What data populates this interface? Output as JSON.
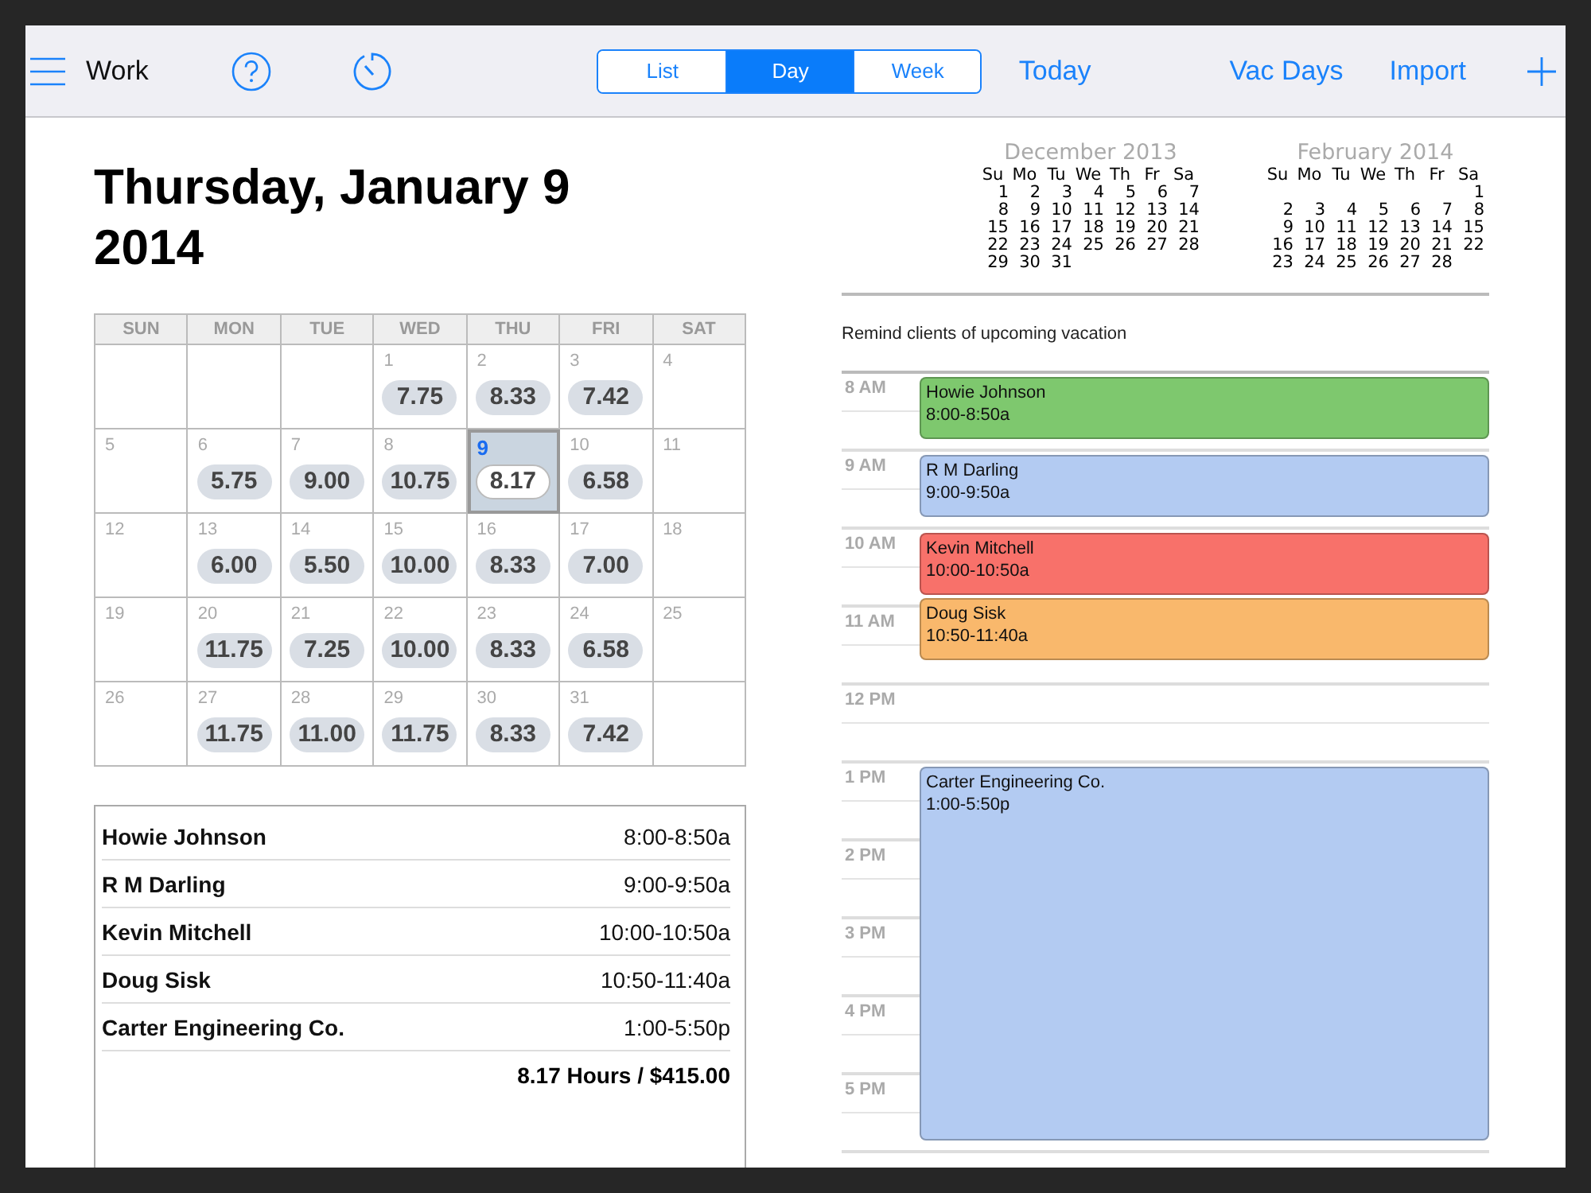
{
  "toolbar": {
    "title": "Work",
    "segments": [
      {
        "label": "List",
        "selected": false
      },
      {
        "label": "Day",
        "selected": true
      },
      {
        "label": "Week",
        "selected": false
      }
    ],
    "links": [
      "Today",
      "Vac Days",
      "Import"
    ]
  },
  "day_title": "Thursday, January 9 2014",
  "month_grid": {
    "weekdays": [
      "SUN",
      "MON",
      "TUE",
      "WED",
      "THU",
      "FRI",
      "SAT"
    ],
    "weeks": [
      [
        {
          "day": "1",
          "hours": "7.75",
          "selected": false
        },
        {
          "day": "2",
          "hours": "8.33",
          "selected": false
        },
        {
          "day": "3",
          "hours": "7.42",
          "selected": false
        },
        {
          "day": "4",
          "selected": false
        }
      ],
      [
        {
          "day": "5",
          "selected": false
        },
        {
          "day": "6",
          "hours": "5.75",
          "selected": false
        },
        {
          "day": "7",
          "hours": "9.00",
          "selected": false
        },
        {
          "day": "8",
          "hours": "10.75",
          "selected": false
        },
        {
          "day": "9",
          "hours": "8.17",
          "selected": true
        },
        {
          "day": "10",
          "hours": "6.58",
          "selected": false
        },
        {
          "day": "11",
          "selected": false
        }
      ],
      [
        {
          "day": "12",
          "selected": false
        },
        {
          "day": "13",
          "hours": "6.00",
          "selected": false
        },
        {
          "day": "14",
          "hours": "5.50",
          "selected": false
        },
        {
          "day": "15",
          "hours": "10.00",
          "selected": false
        },
        {
          "day": "16",
          "hours": "8.33",
          "selected": false
        },
        {
          "day": "17",
          "hours": "7.00",
          "selected": false
        },
        {
          "day": "18",
          "selected": false
        }
      ],
      [
        {
          "day": "19",
          "selected": false
        },
        {
          "day": "20",
          "hours": "11.75",
          "selected": false
        },
        {
          "day": "21",
          "hours": "7.25",
          "selected": false
        },
        {
          "day": "22",
          "hours": "10.00",
          "selected": false
        },
        {
          "day": "23",
          "hours": "8.33",
          "selected": false
        },
        {
          "day": "24",
          "hours": "6.58",
          "selected": false
        },
        {
          "day": "25",
          "selected": false
        }
      ],
      [
        {
          "day": "26",
          "selected": false
        },
        {
          "day": "27",
          "hours": "11.75",
          "selected": false
        },
        {
          "day": "28",
          "hours": "11.00",
          "selected": false
        },
        {
          "day": "29",
          "hours": "11.75",
          "selected": false
        },
        {
          "day": "30",
          "hours": "8.33",
          "selected": false
        },
        {
          "day": "31",
          "hours": "7.42",
          "selected": false
        }
      ]
    ]
  },
  "summary": {
    "rows": [
      {
        "name": "Howie Johnson",
        "time": "8:00-8:50a"
      },
      {
        "name": "R M Darling",
        "time": "9:00-9:50a"
      },
      {
        "name": "Kevin Mitchell",
        "time": "10:00-10:50a"
      },
      {
        "name": "Doug Sisk",
        "time": "10:50-11:40a"
      },
      {
        "name": "Carter Engineering Co.",
        "time": "1:00-5:50p"
      }
    ],
    "total": "8.17 Hours / $415.00"
  },
  "mini_calendars": [
    {
      "title": "December 2013",
      "weekdays": [
        "Su",
        "Mo",
        "Tu",
        "We",
        "Th",
        "Fr",
        "Sa"
      ],
      "weeks": [
        [
          "1",
          "2",
          "3",
          "4",
          "5",
          "6",
          "7"
        ],
        [
          "8",
          "9",
          "10",
          "11",
          "12",
          "13",
          "14"
        ],
        [
          "15",
          "16",
          "17",
          "18",
          "19",
          "20",
          "21"
        ],
        [
          "22",
          "23",
          "24",
          "25",
          "26",
          "27",
          "28"
        ],
        [
          "29",
          "30",
          "31"
        ]
      ]
    },
    {
      "title": "February 2014",
      "weekdays": [
        "Su",
        "Mo",
        "Tu",
        "We",
        "Th",
        "Fr",
        "Sa"
      ],
      "weeks": [
        [
          "1"
        ],
        [
          "2",
          "3",
          "4",
          "5",
          "6",
          "7",
          "8"
        ],
        [
          "9",
          "10",
          "11",
          "12",
          "13",
          "14",
          "15"
        ],
        [
          "16",
          "17",
          "18",
          "19",
          "20",
          "21",
          "22"
        ],
        [
          "23",
          "24",
          "25",
          "26",
          "27",
          "28"
        ]
      ]
    }
  ],
  "reminder": "Remind clients of upcoming vacation",
  "day_view": {
    "hours": [
      "8 AM",
      "9 AM",
      "10 AM",
      "11 AM",
      "12 PM",
      "1 PM",
      "2 PM",
      "3 PM",
      "4 PM",
      "5 PM"
    ],
    "events": [
      {
        "name": "Howie Johnson",
        "time": "8:00-8:50a",
        "color": "#7ec86e"
      },
      {
        "name": "R M Darling",
        "time": "9:00-9:50a",
        "color": "#b3cbf2"
      },
      {
        "name": "Kevin Mitchell",
        "time": "10:00-10:50a",
        "color": "#f8716a"
      },
      {
        "name": "Doug Sisk",
        "time": "10:50-11:40a",
        "color": "#f9b86c"
      },
      {
        "name": "Carter Engineering Co.",
        "time": "1:00-5:50p",
        "color": "#b3cbf2"
      }
    ]
  }
}
